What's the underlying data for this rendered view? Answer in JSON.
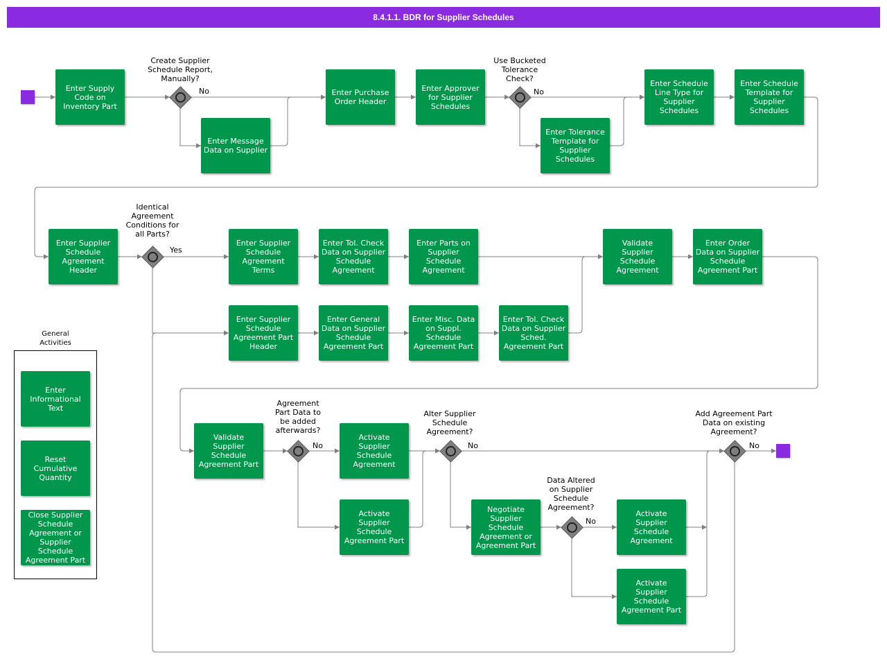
{
  "title": "8.4.1.1. BDR for Supplier Schedules",
  "tasks": {
    "enter_supply_code": "Enter Supply\nCode on\nInventory Part",
    "enter_message_data": "Enter Message\nData on Supplier",
    "enter_po_header": "Enter Purchase\nOrder Header",
    "enter_approver": "Enter Approver\nfor Supplier\nSchedules",
    "enter_tolerance_template": "Enter Tolerance\nTemplate for\nSupplier\nSchedules",
    "enter_schedule_line_type": "Enter Schedule\nLine Type for\nSupplier\nSchedules",
    "enter_schedule_template": "Enter Schedule\nTemplate for\nSupplier\nSchedules",
    "enter_agreement_header": "Enter Supplier\nSchedule\nAgreement\nHeader",
    "enter_agreement_terms": "Enter Supplier\nSchedule\nAgreement\nTerms",
    "enter_tol_check_agreement": "Enter Tol. Check\nData on Supplier\nSchedule\nAgreement",
    "enter_parts": "Enter Parts on\nSupplier\nSchedule\nAgreement",
    "validate_agreement": "Validate\nSupplier\nSchedule\nAgreement",
    "enter_order_data": "Enter Order\nData on Supplier\nSchedule\nAgreement Part",
    "enter_part_header": "Enter Supplier\nSchedule\nAgreement Part\nHeader",
    "enter_general_data": "Enter General\nData on Supplier\nSchedule\nAgreement Part",
    "enter_misc_data": "Enter Misc. Data\non Suppl.\nSchedule\nAgreement Part",
    "enter_tol_check_part": "Enter Tol. Check\nData on Supplier\nSched.\nAgreement Part",
    "validate_part": "Validate\nSupplier\nSchedule\nAgreement Part",
    "activate_agreement_1": "Activate\nSupplier\nSchedule\nAgreement",
    "activate_part_1": "Activate\nSupplier\nSchedule\nAgreement Part",
    "negotiate": "Negotiate\nSupplier\nSchedule\nAgreement or\nAgreement Part",
    "activate_agreement_2": "Activate\nSupplier\nSchedule\nAgreement",
    "activate_part_2": "Activate\nSupplier\nSchedule\nAgreement Part"
  },
  "gateways": {
    "create_report": "Create Supplier\nSchedule Report,\nManually?",
    "bucketed_tolerance": "Use Bucketed\nTolerance\nCheck?",
    "identical_conditions": "Identical\nAgreement\nConditions for\nall Parts?",
    "part_data_afterwards": "Agreement\nPart Data to\nbe added\nafterwards?",
    "alter_agreement": "Alter Supplier\nSchedule\nAgreement?",
    "data_altered": "Data Altered\non Supplier\nSchedule\nAgreement?",
    "add_part_data": "Add Agreement Part\nData on existing\nAgreement?"
  },
  "flow_labels": {
    "no_1": "No",
    "no_2": "No",
    "yes_1": "Yes",
    "no_3": "No",
    "no_4": "No",
    "no_5": "No",
    "no_6": "No"
  },
  "general": {
    "title": "General\nActivities",
    "enter_info_text": "Enter\nInformational\nText",
    "reset_cumulative": "Reset\nCumulative\nQuantity",
    "close_agreement": "Close Supplier\nSchedule\nAgreement or\nSupplier\nSchedule\nAgreement Part"
  },
  "colors": {
    "header": "#8a2be2",
    "task": "#00964b",
    "event": "#8a2be2",
    "gateway": "#7f7f7f",
    "connector": "#7f7f7f"
  }
}
